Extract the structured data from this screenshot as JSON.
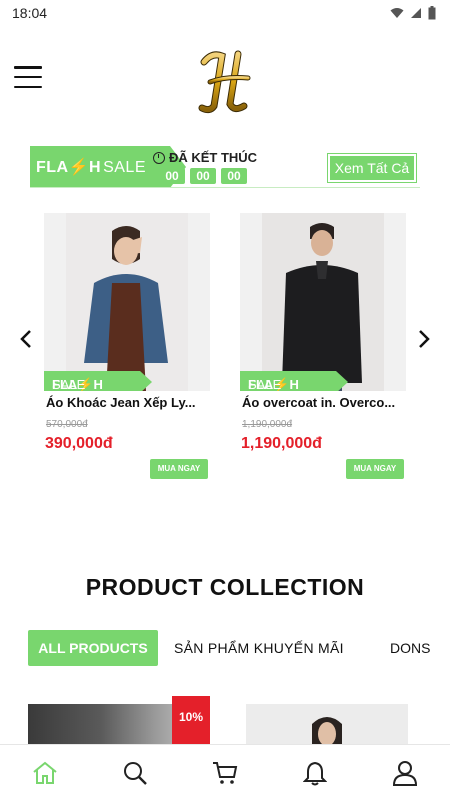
{
  "status_bar": {
    "time": "18:04"
  },
  "flash_sale": {
    "badge_flash": "FLA⚡H",
    "badge_sale": "SALE",
    "status": "ĐÃ KẾT THÚC",
    "hours": "00",
    "minutes": "00",
    "seconds": "00",
    "view_all": "Xem Tất Cả"
  },
  "products": [
    {
      "name": "Áo Khoác Jean Xếp Ly...",
      "old_price": "570,000đ",
      "new_price": "390,000đ",
      "buy_label": "MUA NGAY"
    },
    {
      "name": "Áo overcoat in. Overco...",
      "old_price": "1,190,000đ",
      "new_price": "1,190,000đ",
      "buy_label": "MUA NGAY"
    }
  ],
  "collection": {
    "title": "PRODUCT COLLECTION",
    "tabs": [
      "ALL PRODUCTS",
      "SẢN PHẨM KHUYẾN MÃI",
      "DONS"
    ],
    "discount": "10%"
  },
  "colors": {
    "accent": "#79d66e",
    "price": "#e4202a",
    "logo_gold": "#d9a514"
  },
  "bottom_nav": [
    "home-icon",
    "search-icon",
    "cart-icon",
    "bell-icon",
    "user-icon"
  ]
}
